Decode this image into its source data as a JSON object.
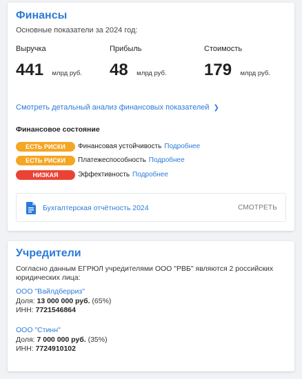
{
  "finance": {
    "title": "Финансы",
    "subtitle": "Основные показатели за 2024 год:",
    "metrics": [
      {
        "label": "Выручка",
        "value": "441",
        "unit": "млрд руб."
      },
      {
        "label": "Прибыль",
        "value": "48",
        "unit": "млрд руб."
      },
      {
        "label": "Стоимость",
        "value": "179",
        "unit": "млрд руб."
      }
    ],
    "detail_link": "Смотреть детальный анализ финансовых показателей",
    "state_title": "Финансовое состояние",
    "statuses": [
      {
        "badge": "ЕСТЬ РИСКИ",
        "badge_color": "#f5a623",
        "text": "Финансовая устойчивость",
        "link": "Подробнее"
      },
      {
        "badge": "ЕСТЬ РИСКИ",
        "badge_color": "#f5a623",
        "text": "Платежеспособность",
        "link": "Подробнее"
      },
      {
        "badge": "НИЗКАЯ",
        "badge_color": "#ea4335",
        "text": "Эффективность",
        "link": "Подробнее"
      }
    ],
    "report": {
      "icon": "document-icon",
      "label": "Бухгалтерская отчётность 2024",
      "action": "СМОТРЕТЬ"
    }
  },
  "founders": {
    "title": "Учредители",
    "intro": "Согласно данным ЕГРЮЛ учредителями ООО \"РВБ\" являются 2 российских юридических лица:",
    "share_label": "Доля:",
    "inn_label": "ИНН:",
    "items": [
      {
        "name": "ООО \"Вайлдберриз\"",
        "share_amount": "13 000 000 руб.",
        "share_pct": "(65%)",
        "inn": "7721546864"
      },
      {
        "name": "ООО \"Стинн\"",
        "share_amount": "7 000 000 руб.",
        "share_pct": "(35%)",
        "inn": "7724910102"
      }
    ]
  },
  "colors": {
    "accent": "#2a7ad8",
    "warning": "#f5a623",
    "danger": "#ea4335",
    "background": "#f1f2f5"
  }
}
